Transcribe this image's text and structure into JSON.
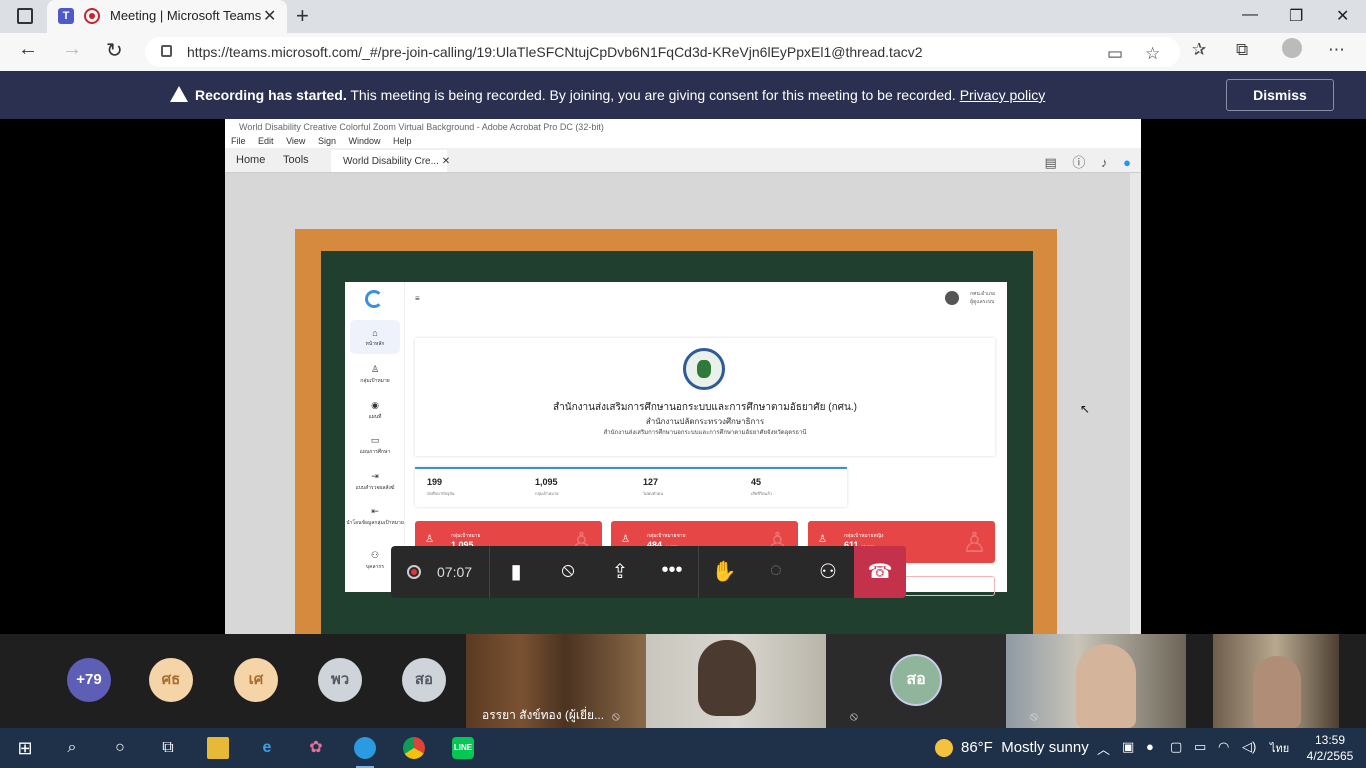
{
  "browser": {
    "tab_title": "Meeting | Microsoft Teams",
    "url": "https://teams.microsoft.com/_#/pre-join-calling/19:UlaTleSFCNtujCpDvb6N1FqCd3d-KReVjn6lEyPpxEl1@thread.tacv2"
  },
  "banner": {
    "title": "Recording has started.",
    "message": "This meeting is being recorded. By joining, you are giving consent for this meeting to be recorded.",
    "link": "Privacy policy",
    "dismiss": "Dismiss"
  },
  "acrobat": {
    "window_title": "World Disability Creative Colorful Zoom Virtual Background - Adobe Acrobat Pro DC (32-bit)",
    "menu": [
      "File",
      "Edit",
      "View",
      "Sign",
      "Window",
      "Help"
    ],
    "tab_home": "Home",
    "tab_tools": "Tools",
    "doc_tab": "World Disability Cre..."
  },
  "dashboard": {
    "sidebar": [
      {
        "icon": "home-icon",
        "label": "หน้าหลัก"
      },
      {
        "icon": "user-icon",
        "label": "กลุ่มเป้าหมาย"
      },
      {
        "icon": "map-pin-icon",
        "label": "แผนที่"
      },
      {
        "icon": "folder-icon",
        "label": "แผนการศึกษา"
      },
      {
        "icon": "logout-icon",
        "label": "แบบสำรวจผลสังฆ์"
      },
      {
        "icon": "login-icon",
        "label": "นำโอนข้อมูลกลุ่มเป้าหมาย"
      },
      {
        "icon": "users-icon",
        "label": "บุคลากร"
      }
    ],
    "user_name": "กศน.อำเภอ",
    "user_role": "ผู้ดูแลระบบ",
    "org_title": "สำนักงานส่งเสริมการศึกษานอกระบบและการศึกษาตามอัธยาศัย (กศน.)",
    "org_sub1": "สำนักงานปลัดกระทรวงศึกษาธิการ",
    "org_sub2": "สำนักงานส่งเสริมการศึกษานอกระบบและการศึกษาตามอัธยาศัยจังหวัดอุดรธานี",
    "stats": [
      {
        "value": "199",
        "label": "นักศึกษาปัจจุบัน"
      },
      {
        "value": "1,095",
        "label": "กลุ่มเป้าหมาย"
      },
      {
        "value": "127",
        "label": "ไม่พบตัวตน"
      },
      {
        "value": "45",
        "label": "เสียชีวิตแล้ว"
      }
    ],
    "cards": [
      {
        "label": "กลุ่มเป้าหมาย",
        "value": "1,095",
        "pct": ""
      },
      {
        "label": "กลุ่มเป้าหมายชาย",
        "value": "484",
        "pct": "44.20%"
      },
      {
        "label": "กลุ่มเป้าหมายหญิง",
        "value": "611",
        "pct": "55.80%"
      }
    ]
  },
  "call": {
    "timer": "07:07"
  },
  "gallery": {
    "overflow": "+79",
    "avatars": [
      {
        "initials": "ศธ",
        "color": "#f5d5a8",
        "text": "#a86e2d"
      },
      {
        "initials": "เศ",
        "color": "#f5d5a8",
        "text": "#a86e2d"
      },
      {
        "initials": "พว",
        "color": "#cfd3da",
        "text": "#555a64"
      },
      {
        "initials": "สอ",
        "color": "#cfd3da",
        "text": "#555a64"
      }
    ],
    "speaking_initials": "สอ",
    "video_name": "อรรยา สังข์ทอง (ผู้เยี่ย..."
  },
  "taskbar": {
    "temperature": "86°F",
    "weather": "Mostly sunny",
    "lang": "ไทย",
    "time": "13:59",
    "date": "4/2/2565"
  }
}
